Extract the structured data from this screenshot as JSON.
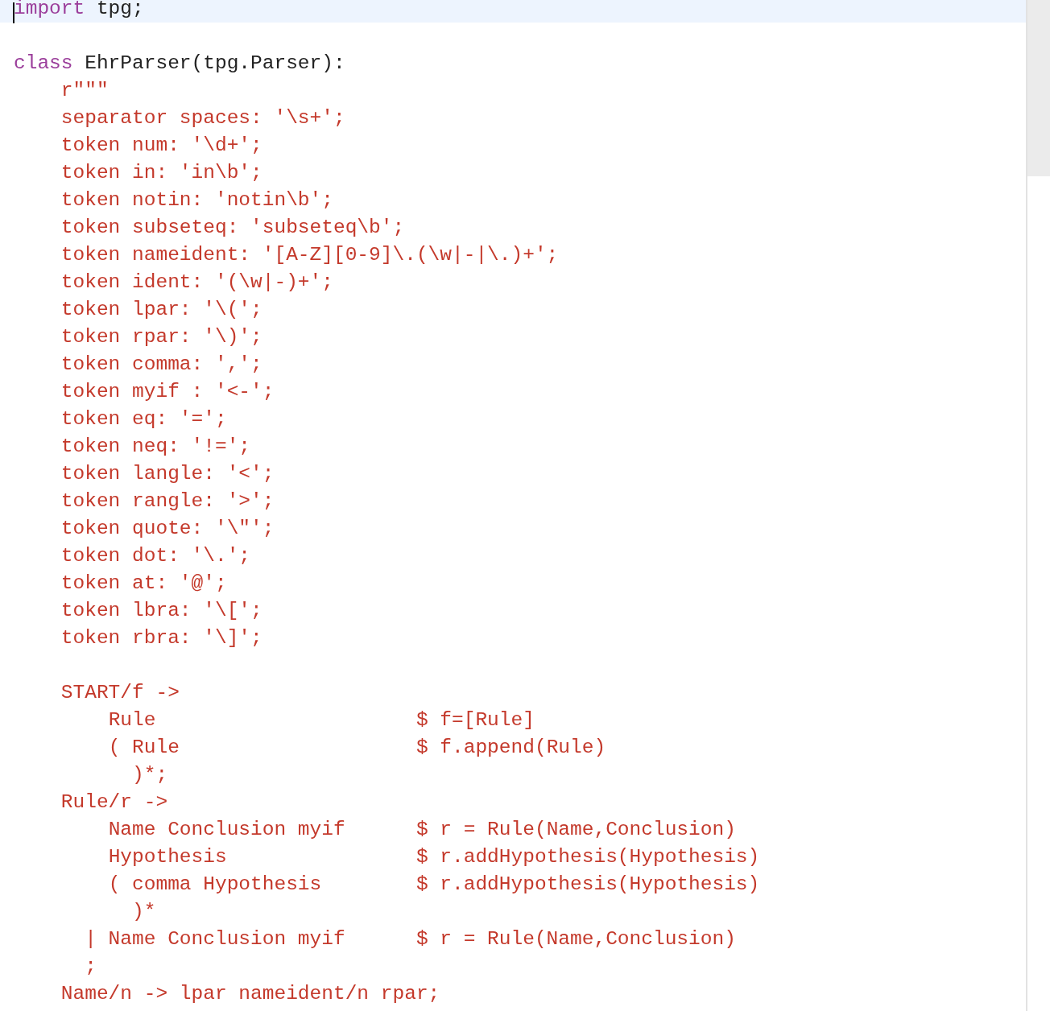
{
  "editor": {
    "lines": [
      {
        "current": true,
        "cursor": true,
        "segments": [
          {
            "kind": "keyword",
            "text": "import"
          },
          {
            "kind": "plain",
            "text": " tpg;"
          }
        ]
      },
      {
        "current": false
      },
      {
        "current": false,
        "segments": [
          {
            "kind": "keyword",
            "text": "class"
          },
          {
            "kind": "plain",
            "text": " EhrParser(tpg.Parser):"
          }
        ]
      },
      {
        "current": false,
        "segments": [
          {
            "kind": "string",
            "text": "    r\"\"\""
          }
        ]
      },
      {
        "current": false,
        "segments": [
          {
            "kind": "string",
            "text": "    separator spaces: '\\s+';"
          }
        ]
      },
      {
        "current": false,
        "segments": [
          {
            "kind": "string",
            "text": "    token num: '\\d+';"
          }
        ]
      },
      {
        "current": false,
        "segments": [
          {
            "kind": "string",
            "text": "    token in: 'in\\b';"
          }
        ]
      },
      {
        "current": false,
        "segments": [
          {
            "kind": "string",
            "text": "    token notin: 'notin\\b';"
          }
        ]
      },
      {
        "current": false,
        "segments": [
          {
            "kind": "string",
            "text": "    token subseteq: 'subseteq\\b';"
          }
        ]
      },
      {
        "current": false,
        "segments": [
          {
            "kind": "string",
            "text": "    token nameident: '[A-Z][0-9]\\.(\\w|-|\\.)+';"
          }
        ]
      },
      {
        "current": false,
        "segments": [
          {
            "kind": "string",
            "text": "    token ident: '(\\w|-)+';"
          }
        ]
      },
      {
        "current": false,
        "segments": [
          {
            "kind": "string",
            "text": "    token lpar: '\\(';"
          }
        ]
      },
      {
        "current": false,
        "segments": [
          {
            "kind": "string",
            "text": "    token rpar: '\\)';"
          }
        ]
      },
      {
        "current": false,
        "segments": [
          {
            "kind": "string",
            "text": "    token comma: ',';"
          }
        ]
      },
      {
        "current": false,
        "segments": [
          {
            "kind": "string",
            "text": "    token myif : '<-';"
          }
        ]
      },
      {
        "current": false,
        "segments": [
          {
            "kind": "string",
            "text": "    token eq: '=';"
          }
        ]
      },
      {
        "current": false,
        "segments": [
          {
            "kind": "string",
            "text": "    token neq: '!=';"
          }
        ]
      },
      {
        "current": false,
        "segments": [
          {
            "kind": "string",
            "text": "    token langle: '<';"
          }
        ]
      },
      {
        "current": false,
        "segments": [
          {
            "kind": "string",
            "text": "    token rangle: '>';"
          }
        ]
      },
      {
        "current": false,
        "segments": [
          {
            "kind": "string",
            "text": "    token quote: '\\\"';"
          }
        ]
      },
      {
        "current": false,
        "segments": [
          {
            "kind": "string",
            "text": "    token dot: '\\.';"
          }
        ]
      },
      {
        "current": false,
        "segments": [
          {
            "kind": "string",
            "text": "    token at: '@';"
          }
        ]
      },
      {
        "current": false,
        "segments": [
          {
            "kind": "string",
            "text": "    token lbra: '\\[';"
          }
        ]
      },
      {
        "current": false,
        "segments": [
          {
            "kind": "string",
            "text": "    token rbra: '\\]';"
          }
        ]
      },
      {
        "current": false
      },
      {
        "current": false,
        "segments": [
          {
            "kind": "string",
            "text": "    START/f ->"
          }
        ]
      },
      {
        "current": false,
        "segments": [
          {
            "kind": "string",
            "text": "        Rule"
          },
          {
            "kind": "string",
            "text": "                      $ f=[Rule]"
          }
        ]
      },
      {
        "current": false,
        "segments": [
          {
            "kind": "string",
            "text": "        ( Rule"
          },
          {
            "kind": "string",
            "text": "                    $ f.append(Rule)"
          }
        ]
      },
      {
        "current": false,
        "segments": [
          {
            "kind": "string",
            "text": "          )*;"
          }
        ]
      },
      {
        "current": false,
        "segments": [
          {
            "kind": "string",
            "text": "    Rule/r ->"
          }
        ]
      },
      {
        "current": false,
        "segments": [
          {
            "kind": "string",
            "text": "        Name Conclusion myif"
          },
          {
            "kind": "string",
            "text": "      $ r = Rule(Name,Conclusion)"
          }
        ]
      },
      {
        "current": false,
        "segments": [
          {
            "kind": "string",
            "text": "        Hypothesis"
          },
          {
            "kind": "string",
            "text": "                $ r.addHypothesis(Hypothesis)"
          }
        ]
      },
      {
        "current": false,
        "segments": [
          {
            "kind": "string",
            "text": "        ( comma Hypothesis"
          },
          {
            "kind": "string",
            "text": "        $ r.addHypothesis(Hypothesis)"
          }
        ]
      },
      {
        "current": false,
        "segments": [
          {
            "kind": "string",
            "text": "          )*"
          }
        ]
      },
      {
        "current": false,
        "segments": [
          {
            "kind": "string",
            "text": "      | Name Conclusion myif"
          },
          {
            "kind": "string",
            "text": "      $ r = Rule(Name,Conclusion)"
          }
        ]
      },
      {
        "current": false,
        "segments": [
          {
            "kind": "string",
            "text": "      ;"
          }
        ]
      },
      {
        "current": false,
        "segments": [
          {
            "kind": "string",
            "text": "    Name/n -> lpar nameident/n rpar;"
          }
        ]
      }
    ]
  }
}
